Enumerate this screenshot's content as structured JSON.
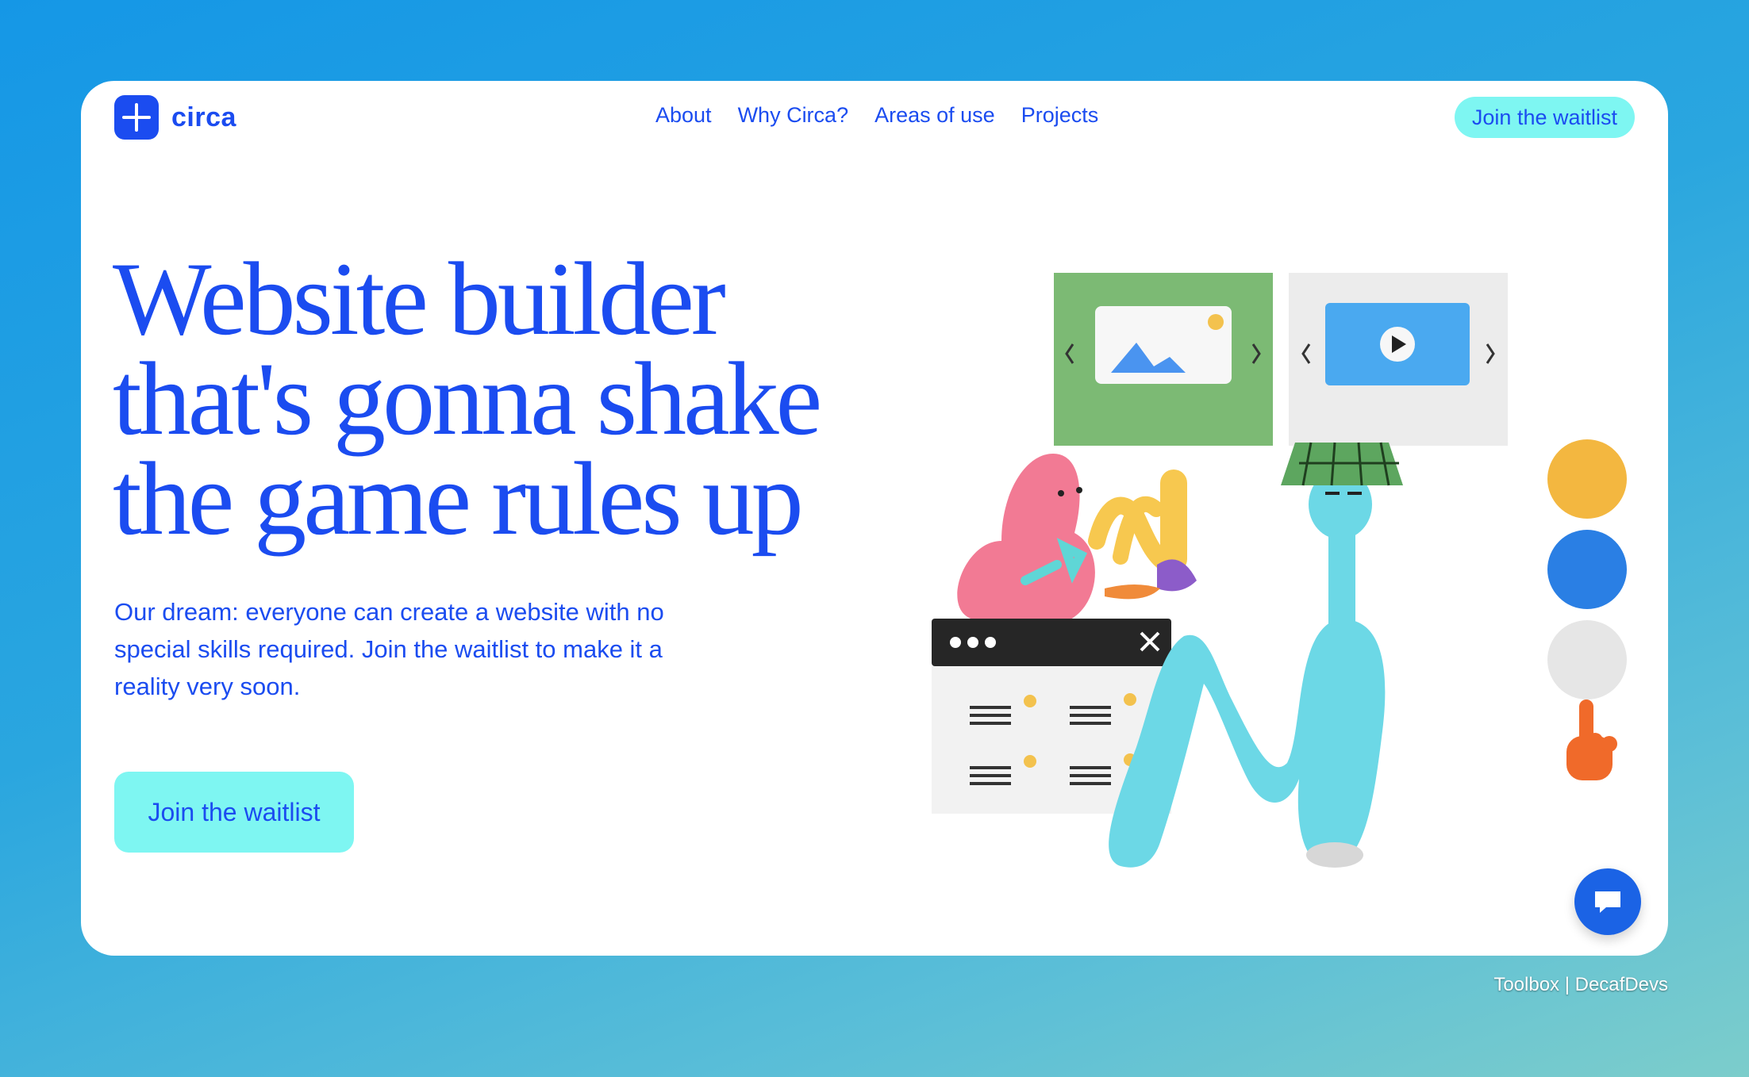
{
  "brand": {
    "name": "circa",
    "icon": "plus-sparkle-icon"
  },
  "nav": {
    "items": [
      "About",
      "Why Circa?",
      "Areas of use",
      "Projects"
    ]
  },
  "header": {
    "cta_label": "Join the waitlist"
  },
  "hero": {
    "title_lines": [
      "Website builder",
      "that's gonna shake",
      "the game rules up"
    ],
    "body": "Our dream: everyone can create a website with no special skills required. Join the waitlist to make it a reality very soon.",
    "cta_label": "Join the waitlist"
  },
  "chat": {
    "icon": "chat-bubble-icon"
  },
  "footer": {
    "credit": "Toolbox | DecafDevs"
  },
  "colors": {
    "accent": "#1b4cf0",
    "cta_bg": "#7ef6f2",
    "background_top": "#1597e6",
    "background_bottom": "#7ccdcb"
  }
}
